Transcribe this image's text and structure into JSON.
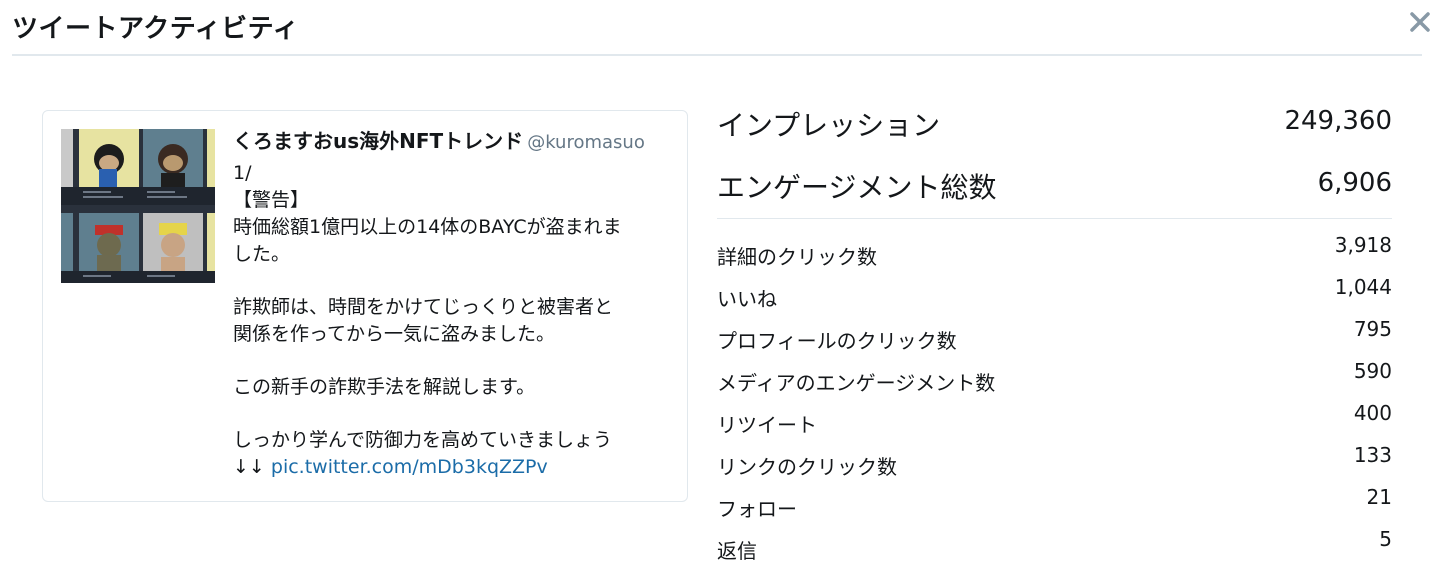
{
  "header": {
    "title": "ツイートアクティビティ"
  },
  "tweet": {
    "author_name": "くろますおus海外NFTトレンド",
    "author_handle": "@kuromasuo",
    "lines": [
      "1/",
      "【警告】",
      "時価総額1億円以上の14体のBAYCが盗まれま",
      "した。",
      "",
      "詐欺師は、時間をかけてじっくりと被害者と",
      "関係を作ってから一気に盗みました。",
      "",
      "この新手の詐欺手法を解説します。",
      "",
      "しっかり学んで防御力を高めていきましょう"
    ],
    "last_line_prefix": "↓↓ ",
    "link_text": "pic.twitter.com/mDb3kqZZPv"
  },
  "stats": {
    "impressions": {
      "label": "インプレッション",
      "value": "249,360"
    },
    "engagements": {
      "label": "エンゲージメント総数",
      "value": "6,906"
    },
    "rows": [
      {
        "label": "詳細のクリック数",
        "value": "3,918"
      },
      {
        "label": "いいね",
        "value": "1,044"
      },
      {
        "label": "プロフィールのクリック数",
        "value": "795"
      },
      {
        "label": "メディアのエンゲージメント数",
        "value": "590"
      },
      {
        "label": "リツイート",
        "value": "400"
      },
      {
        "label": "リンクのクリック数",
        "value": "133"
      },
      {
        "label": "フォロー",
        "value": "21"
      },
      {
        "label": "返信",
        "value": "5"
      }
    ]
  },
  "icons": {
    "close": "close-icon",
    "media": "nft-grid-thumbnail"
  },
  "colors": {
    "link": "#1b6ca8",
    "handle": "#657786",
    "divider": "#e1e8ed"
  }
}
